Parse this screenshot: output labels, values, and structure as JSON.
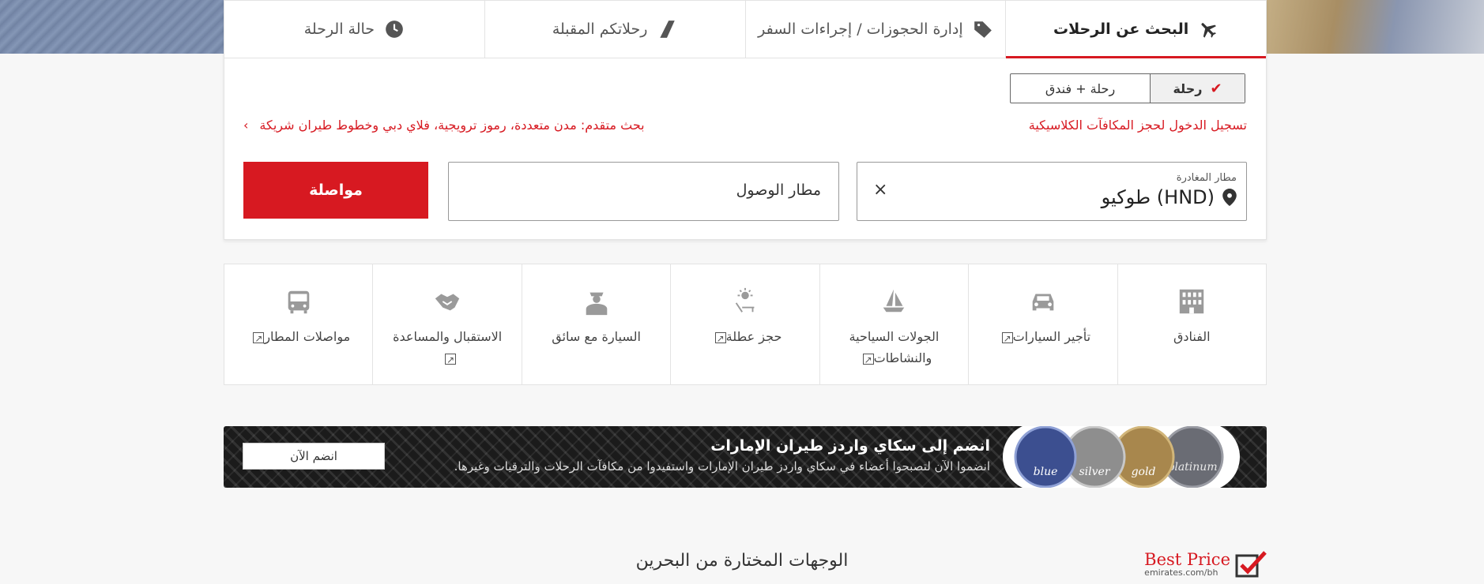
{
  "tabs": [
    {
      "label": "البحث عن الرحلات",
      "icon": "plane-icon",
      "active": true
    },
    {
      "label": "إدارة الحجوزات / إجراءات السفر",
      "icon": "tag-icon",
      "active": false
    },
    {
      "label": "رحلاتكم المقبلة",
      "icon": "boarding-pass-icon",
      "active": false
    },
    {
      "label": "حالة الرحلة",
      "icon": "clock-icon",
      "active": false
    }
  ],
  "trip_type": {
    "selected": "رحلة",
    "other": "رحلة + فندق"
  },
  "links": {
    "classic_rewards": "تسجيل الدخول لحجز المكافآت الكلاسيكية",
    "advanced_search": "بحث متقدم: مدن متعددة، رموز ترويجية، فلاي دبي وخطوط طيران شريكة"
  },
  "departure": {
    "label": "مطار المغادرة",
    "value": "طوكيو (HND)",
    "clear": "×"
  },
  "arrival": {
    "placeholder": "مطار الوصول"
  },
  "continue_label": "مواصلة",
  "services": [
    {
      "label": "الفنادق",
      "external": false,
      "icon": "hotel-icon"
    },
    {
      "label": "تأجير السيارات",
      "external": true,
      "icon": "car-icon"
    },
    {
      "label": "الجولات السياحية والنشاطات",
      "external": true,
      "icon": "sailboat-icon"
    },
    {
      "label": "حجز عطلة",
      "external": true,
      "icon": "beach-chair-icon"
    },
    {
      "label": "السيارة مع سائق",
      "external": false,
      "icon": "chauffeur-icon"
    },
    {
      "label": "الاستقبال والمساعدة",
      "external": true,
      "icon": "handshake-icon"
    },
    {
      "label": "مواصلات المطار",
      "external": true,
      "icon": "bus-icon"
    }
  ],
  "banner": {
    "title": "انضم إلى سكاي واردز طيران الإمارات",
    "subtitle": "انضموا الآن لتصبحوا أعضاء في سكاي واردز طيران الإمارات واستفيدوا من مكافآت الرحلات والترقيات وغيرها.",
    "join_label": "انضم الآن",
    "medals": [
      "blue",
      "silver",
      "gold",
      "platinum"
    ]
  },
  "destinations_title": "الوجهات المختارة من البحرين",
  "best_price": {
    "text": "Best Price",
    "sub": "emirates.com/bh"
  },
  "colors": {
    "accent": "#d71921"
  }
}
